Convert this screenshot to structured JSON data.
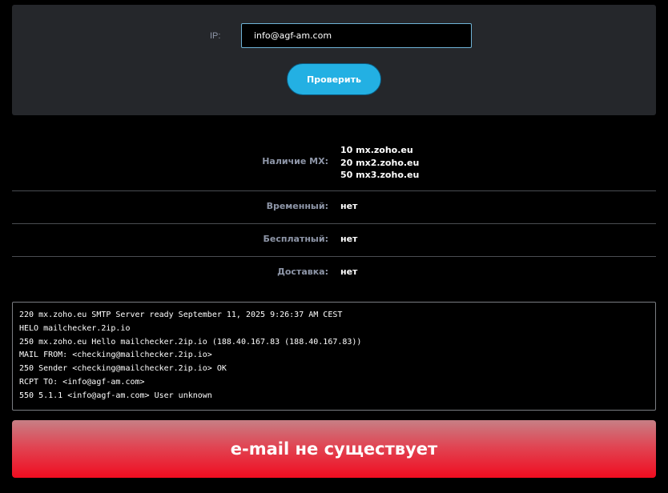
{
  "form": {
    "ip_label": "IP:",
    "ip_value": "info@agf-am.com",
    "check_button": "Проверить",
    "accent_color": "#23b0e3"
  },
  "results": {
    "mx": {
      "label": "Наличие MX:",
      "records": [
        "10 mx.zoho.eu",
        "20 mx2.zoho.eu",
        "50 mx3.zoho.eu"
      ]
    },
    "temporary": {
      "label": "Временный:",
      "value": "нет"
    },
    "free": {
      "label": "Бесплатный:",
      "value": "нет"
    },
    "delivery": {
      "label": "Доставка:",
      "value": "нет"
    }
  },
  "smtp_log": [
    "220 mx.zoho.eu SMTP Server ready September 11, 2025 9:26:37 AM CEST",
    "HELO mailchecker.2ip.io",
    "250 mx.zoho.eu Hello mailchecker.2ip.io (188.40.167.83 (188.40.167.83))",
    "MAIL FROM: <checking@mailchecker.2ip.io>",
    "250 Sender <checking@mailchecker.2ip.io> OK",
    "RCPT TO: <info@agf-am.com>",
    "550 5.1.1 <info@agf-am.com> User unknown"
  ],
  "verdict": {
    "text": "e-mail не существует",
    "color": "#f00c20"
  }
}
